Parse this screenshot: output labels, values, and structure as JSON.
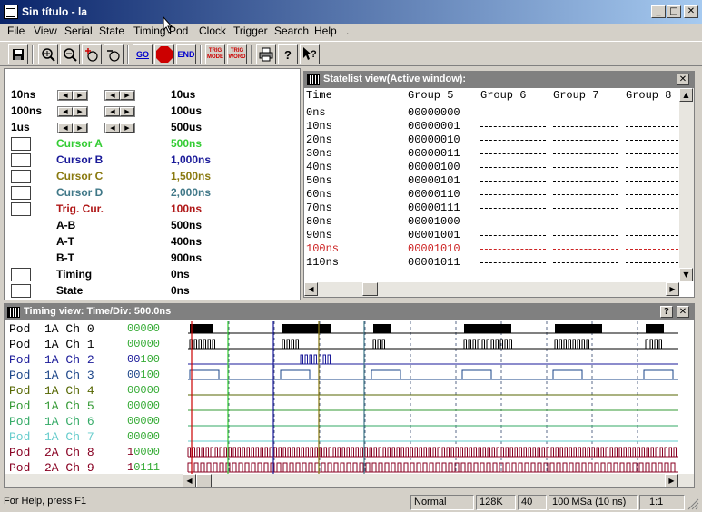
{
  "window": {
    "title": "Sin título - la",
    "min": "_",
    "max": "□",
    "close": "✕"
  },
  "menu": [
    "File",
    "View",
    "Serial",
    "State",
    "Timing",
    "Pod",
    "Clock",
    "Trigger",
    "Search",
    "Help",
    "."
  ],
  "toolbar": {
    "go": "GO",
    "stop": "STOP",
    "end": "END",
    "trig_mode": "TRIG MODE",
    "trig_word": "TRIG WORD",
    "help_q": "?"
  },
  "left": {
    "scale_rows": [
      {
        "label": "10ns",
        "value": "10us"
      },
      {
        "label": "100ns",
        "value": "100us"
      },
      {
        "label": "1us",
        "value": "500us"
      }
    ],
    "cursors": [
      {
        "label": "Cursor A",
        "value": "500ns",
        "color": "#33cc33"
      },
      {
        "label": "Cursor B",
        "value": "1,000ns",
        "color": "#1a1a99"
      },
      {
        "label": "Cursor C",
        "value": "1,500ns",
        "color": "#8a7a10"
      },
      {
        "label": "Cursor D",
        "value": "2,000ns",
        "color": "#407888"
      },
      {
        "label": "Trig. Cur.",
        "value": "100ns",
        "color": "#b01818"
      }
    ],
    "diffs": [
      {
        "label": "A-B",
        "value": "500ns"
      },
      {
        "label": "A-T",
        "value": "400ns"
      },
      {
        "label": "B-T",
        "value": "900ns"
      }
    ],
    "modes": [
      {
        "label": "Timing",
        "value": "0ns"
      },
      {
        "label": "State",
        "value": "0ns"
      }
    ]
  },
  "statelist": {
    "title": "Statelist view(Active window):",
    "columns": [
      "Time",
      "Group 5",
      "Group 6",
      "Group 7",
      "Group 8"
    ],
    "rows": [
      {
        "time": "0ns",
        "g5": "00000000"
      },
      {
        "time": "10ns",
        "g5": "00000001"
      },
      {
        "time": "20ns",
        "g5": "00000010"
      },
      {
        "time": "30ns",
        "g5": "00000011"
      },
      {
        "time": "40ns",
        "g5": "00000100"
      },
      {
        "time": "50ns",
        "g5": "00000101"
      },
      {
        "time": "60ns",
        "g5": "00000110"
      },
      {
        "time": "70ns",
        "g5": "00000111"
      },
      {
        "time": "80ns",
        "g5": "00001000"
      },
      {
        "time": "90ns",
        "g5": "00001001"
      },
      {
        "time": "100ns",
        "g5": "00001010",
        "highlight": true
      },
      {
        "time": "110ns",
        "g5": "00001011"
      }
    ],
    "dash": "---------"
  },
  "timing": {
    "title": "Timing view:  Time/Div: 500.0ns",
    "help": "?",
    "channels": [
      {
        "label": "Pod  1A Ch 0",
        "value": "00000",
        "color": "#000000",
        "lead": 0
      },
      {
        "label": "Pod  1A Ch 1",
        "value": "00000",
        "color": "#000000",
        "lead": 0
      },
      {
        "label": "Pod  1A Ch 2",
        "value": "00100",
        "color": "#1a1a99",
        "lead": 2
      },
      {
        "label": "Pod  1A Ch 3",
        "value": "00100",
        "color": "#1a4488",
        "lead": 2
      },
      {
        "label": "Pod  1A Ch 4",
        "value": "00000",
        "color": "#556600",
        "lead": 0
      },
      {
        "label": "Pod  1A Ch 5",
        "value": "00000",
        "color": "#339933",
        "lead": 0
      },
      {
        "label": "Pod  1A Ch 6",
        "value": "00000",
        "color": "#33aa66",
        "lead": 0
      },
      {
        "label": "Pod  1A Ch 7",
        "value": "00000",
        "color": "#66cccc",
        "lead": 0
      },
      {
        "label": "Pod  2A Ch 8",
        "value": "10000",
        "color": "#880022",
        "lead": 1
      },
      {
        "label": "Pod  2A Ch 9",
        "value": "10111",
        "color": "#880022",
        "lead": 1
      }
    ]
  },
  "status": {
    "help": "For Help, press F1",
    "mode": "Normal",
    "mem": "128K",
    "n": "40",
    "rate": "100 MSa  (10 ns)",
    "ratio": "1:1"
  },
  "colors": {
    "cursor_a": "#33cc33",
    "cursor_b": "#1a1a99",
    "cursor_c": "#8a7a10",
    "cursor_d": "#407888",
    "trigger": "#cc0000"
  }
}
